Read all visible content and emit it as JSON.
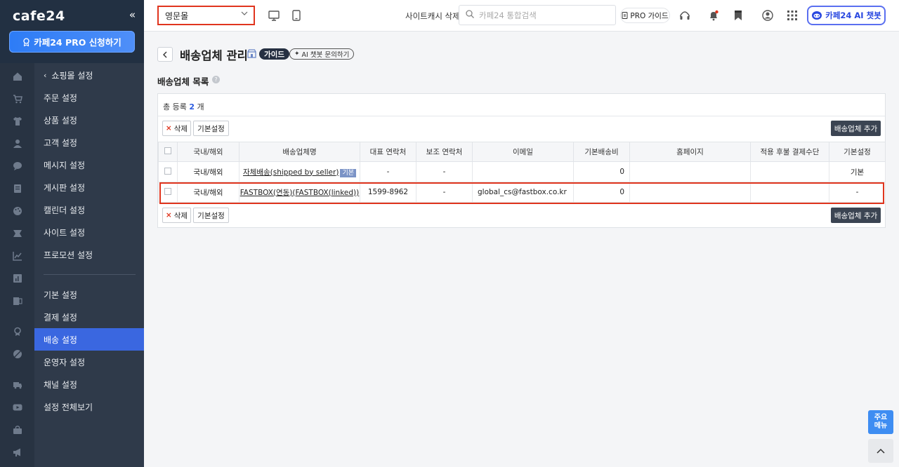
{
  "sidebar": {
    "logo": "cafe24",
    "collapse": "«",
    "pro_button": "카페24 PRO 신청하기",
    "back_label": "쇼핑몰 설정",
    "items": [
      {
        "label": "주문 설정"
      },
      {
        "label": "상품 설정"
      },
      {
        "label": "고객 설정"
      },
      {
        "label": "메시지 설정"
      },
      {
        "label": "게시판 설정"
      },
      {
        "label": "캘린더 설정"
      },
      {
        "label": "사이트 설정"
      },
      {
        "label": "프로모션 설정"
      }
    ],
    "items2": [
      {
        "label": "기본 설정"
      },
      {
        "label": "결제 설정"
      },
      {
        "label": "배송 설정",
        "active": true
      },
      {
        "label": "운영자 설정"
      },
      {
        "label": "채널 설정"
      },
      {
        "label": "설정 전체보기"
      }
    ]
  },
  "header": {
    "mall_select": "영문몰",
    "cache_delete": "사이트캐시 삭제",
    "search_placeholder": "카페24 통합검색",
    "pro_guide": "PRO 가이드",
    "ai_chat": "카페24 AI 챗봇"
  },
  "page": {
    "title": "배송업체 관리",
    "guide": "가이드",
    "ai_inquiry": "AI 챗봇 문의하기",
    "section_title": "배송업체 목록",
    "total_prefix": "총 등록",
    "total_count": "2",
    "total_suffix": "개",
    "delete_btn": "삭제",
    "default_btn": "기본설정",
    "add_btn": "배송업체 추가"
  },
  "table": {
    "headers": [
      "",
      "국내/해외",
      "배송업체명",
      "대표 연락처",
      "보조 연락처",
      "이메일",
      "기본배송비",
      "홈페이지",
      "적용 후불 결제수단",
      "기본설정"
    ],
    "rows": [
      {
        "region": "국내/해외",
        "name": "자체배송(shipped by seller)",
        "badge": "기본",
        "phone": "-",
        "phone2": "-",
        "email": "",
        "fee": "0",
        "homepage": "",
        "postpay": "",
        "default": "기본"
      },
      {
        "region": "국내/해외",
        "name": "FASTBOX(연동)(FASTBOX(linked))",
        "badge": "",
        "phone": "1599-8962",
        "phone2": "-",
        "email": "global_cs@fastbox.co.kr",
        "fee": "0",
        "homepage": "",
        "postpay": "",
        "default": "-"
      }
    ]
  },
  "floating": {
    "main_menu": "주요\n메뉴"
  },
  "colors": {
    "accent": "#3a67e0",
    "highlight": "#e0351e",
    "sidebar_bg": "#2f3a4a"
  }
}
